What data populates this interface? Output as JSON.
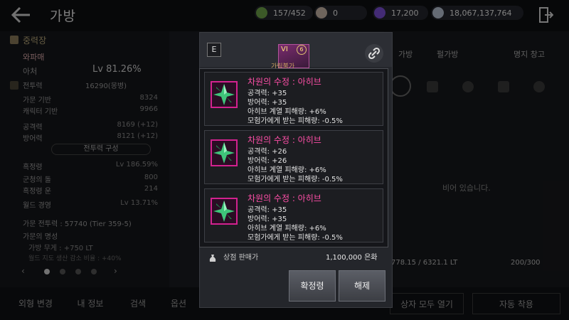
{
  "header": {
    "title": "가방",
    "resources": [
      {
        "value": "157/452",
        "color": "#6ea34a"
      },
      {
        "value": "0",
        "color": "#c9b6a8"
      },
      {
        "value": "17,200",
        "color": "#7a4fd6"
      },
      {
        "value": "18,067,137,764",
        "color": "#b9c3d3"
      }
    ]
  },
  "left_panel": {
    "section": "중력장",
    "name": "와파매",
    "level_label": "아처",
    "level_value": "Lv 81.26%",
    "combat_label": "전투력",
    "combat_value": "16290(몽병)",
    "rows": [
      {
        "label": "가문 기반",
        "value": "8324"
      },
      {
        "label": "캐릭터 기반",
        "value": "9966"
      },
      {
        "label": "공격력",
        "value": "8169 (+12)"
      },
      {
        "label": "방어력",
        "value": "8121 (+12)"
      }
    ],
    "combat_build": "전투력 구성",
    "rows2": [
      {
        "label": "흑정령",
        "value": "Lv 186.59%"
      },
      {
        "label": "군청의 돌",
        "value": "800"
      },
      {
        "label": "흑정령 운",
        "value": "214"
      },
      {
        "label": "월드 경영",
        "value": "Lv 13.71%"
      }
    ],
    "family_combat": "가문 전투력 : 57740 (Tier 359-5)",
    "family_trait": "가문의 명성",
    "weight": "가방 무게 : +750 LT",
    "extra": "월드 지도 생산 감소 비율 : +40%"
  },
  "right_panel": {
    "tabs": [
      "가방",
      "펄가방",
      "창고",
      "명지 창고"
    ],
    "empty": "비어 있습니다.",
    "weight": "778.15 / 6321.1 LT",
    "slots": "200/300",
    "open_all": "상자 모두 열기",
    "auto_equip": "자동 착용"
  },
  "bottom_tabs": [
    "외형 변경",
    "내 정보",
    "검색",
    "옵션"
  ],
  "popup": {
    "badge": "E",
    "header_label": "가림불가",
    "tier": "VI",
    "level": "6",
    "gems": [
      {
        "name": "차원의 수정 : 아히브",
        "stats": [
          "공격력: +35",
          "방어력: +35",
          "아히브 계열 피해량: +6%",
          "모험가에게 받는 피해량: -0.5%"
        ]
      },
      {
        "name": "차원의 수정 : 아히브",
        "stats": [
          "공격력: +26",
          "방어력: +26",
          "아히브 계열 피해량: +6%",
          "모험가에게 받는 피해량: -0.5%"
        ]
      },
      {
        "name": "차원의 수정 : 아히브",
        "stats": [
          "공격력: +35",
          "방어력: +35",
          "아히브 계열 피해량: +6%",
          "모험가에게 받는 피해량: -0.5%"
        ]
      }
    ],
    "shop_label": "상점 판매가",
    "shop_price": "1,100,000 은화",
    "buttons": {
      "confirm": "확정령",
      "release": "해제"
    }
  }
}
